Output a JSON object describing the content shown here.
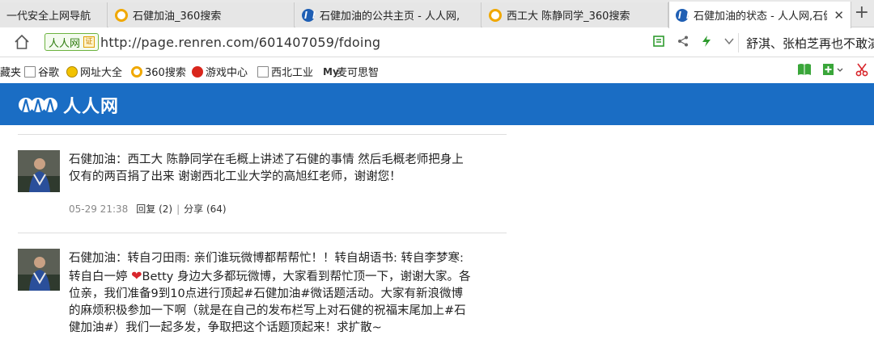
{
  "tabs": [
    {
      "label": "一代安全上网导航",
      "icon": "none"
    },
    {
      "label": "石健加油_360搜索",
      "icon": "360-icon"
    },
    {
      "label": "石健加油的公共主页 - 人人网,",
      "icon": "renren-icon"
    },
    {
      "label": "西工大 陈静同学_360搜索",
      "icon": "360-icon"
    },
    {
      "label": "石健加油的状态 - 人人网,石健",
      "icon": "renren-icon",
      "active": true
    }
  ],
  "address": {
    "site_badge": "人人网",
    "cert_char": "证",
    "url": "http://page.renren.com/601407059/fdoing",
    "news": "舒淇、张柏芝再也不敢演"
  },
  "bookmarks": [
    {
      "label": "藏夹"
    },
    {
      "label": "谷歌",
      "icon": "doc-icon"
    },
    {
      "label": "网址大全",
      "icon": "globe-icon"
    },
    {
      "label": "360搜索",
      "icon": "360-icon"
    },
    {
      "label": "游戏中心",
      "icon": "game-icon"
    },
    {
      "label": "西北工业",
      "icon": "doc-icon"
    },
    {
      "label": "麦可思智",
      "icon": "my-icon",
      "glyph": "My"
    }
  ],
  "header": {
    "logo_text": "人人网"
  },
  "posts": [
    {
      "text": "石健加油：西工大 陈静同学在毛概上讲述了石健的事情 然后毛概老师把身上仅有的两百捐了出来 谢谢西北工业大学的高旭红老师，谢谢您！",
      "time": "05-29 21:38",
      "reply": "回复 (2)",
      "share": "分享 (64)"
    },
    {
      "text_before_heart": "石健加油：转自刁田雨: 亲们谁玩微博都帮帮忙！！转自胡语书: 转自李梦寒: 转自白一婷 ",
      "text_after_heart": "Betty 身边大多都玩微博，大家看到帮忙顶一下，谢谢大家。各位亲，我们准备9到10点进行顶起#石健加油#微话题活动。大家有新浪微博的麻烦积极参加一下啊（就是在自己的发布栏写上对石健的祝福末尾加上#石健加油#）我们一起多发，争取把这个话题顶起来！求扩散~"
    }
  ],
  "colors": {
    "header_blue": "#1a6dc4",
    "tabbar": "#e8e8e8"
  }
}
